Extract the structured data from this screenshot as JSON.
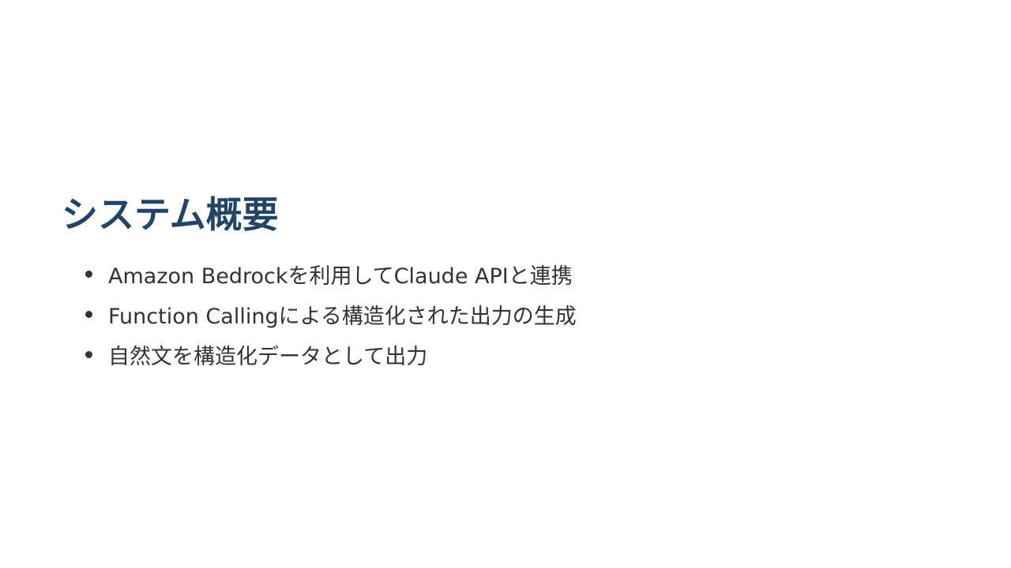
{
  "slide": {
    "title": "システム概要",
    "bullets": [
      "Amazon Bedrockを利用してClaude APIと連携",
      "Function Callingによる構造化された出力の生成",
      "自然文を構造化データとして出力"
    ]
  },
  "colors": {
    "title": "#224466",
    "body_text": "#333333",
    "background": "#ffffff"
  }
}
